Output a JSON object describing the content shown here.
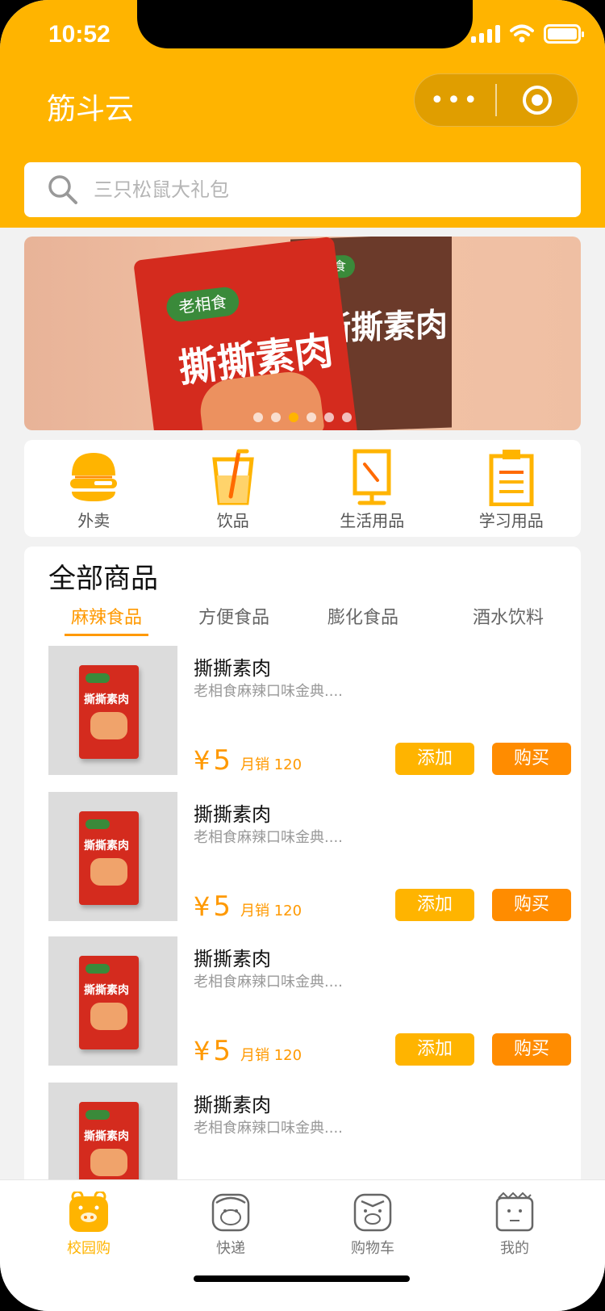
{
  "status_bar": {
    "time": "10:52"
  },
  "header": {
    "app_title": "筋斗云",
    "more_label": "•••"
  },
  "search": {
    "placeholder": "三只松鼠大礼包"
  },
  "banner": {
    "back_pack_brand": "老相食",
    "back_pack_text": "撕撕素肉",
    "front_pack_brand": "老相食",
    "front_pack_text": "撕撕素肉",
    "dots": 6,
    "active_dot": 2
  },
  "categories": [
    {
      "label": "外卖",
      "icon": "burger-icon"
    },
    {
      "label": "饮品",
      "icon": "drink-icon"
    },
    {
      "label": "生活用品",
      "icon": "mirror-icon"
    },
    {
      "label": "学习用品",
      "icon": "notebook-icon"
    }
  ],
  "goods": {
    "title": "全部商品",
    "tabs": [
      "麻辣食品",
      "方便食品",
      "膨化食品",
      "酒水饮料"
    ],
    "active_tab": 0,
    "items": [
      {
        "name": "撕撕素肉",
        "desc": "老相食麻辣口味金典....",
        "currency": "¥",
        "price": "5",
        "sales": "月销 120",
        "add_label": "添加",
        "buy_label": "购买",
        "bag_text": "撕撕素肉"
      },
      {
        "name": "撕撕素肉",
        "desc": "老相食麻辣口味金典....",
        "currency": "¥",
        "price": "5",
        "sales": "月销 120",
        "add_label": "添加",
        "buy_label": "购买",
        "bag_text": "撕撕素肉"
      },
      {
        "name": "撕撕素肉",
        "desc": "老相食麻辣口味金典....",
        "currency": "¥",
        "price": "5",
        "sales": "月销 120",
        "add_label": "添加",
        "buy_label": "购买",
        "bag_text": "撕撕素肉"
      },
      {
        "name": "撕撕素肉",
        "desc": "老相食麻辣口味金典....",
        "bag_text": "撕撕素肉"
      }
    ]
  },
  "tabbar": [
    {
      "label": "校园购",
      "icon": "pig-face-icon",
      "active": true
    },
    {
      "label": "快递",
      "icon": "monkey-face-icon",
      "active": false
    },
    {
      "label": "购物车",
      "icon": "pigsy-face-icon",
      "active": false
    },
    {
      "label": "我的",
      "icon": "monk-face-icon",
      "active": false
    }
  ],
  "colors": {
    "brand": "#ffb400",
    "accent": "#ff8c00",
    "price": "#ff9900"
  }
}
